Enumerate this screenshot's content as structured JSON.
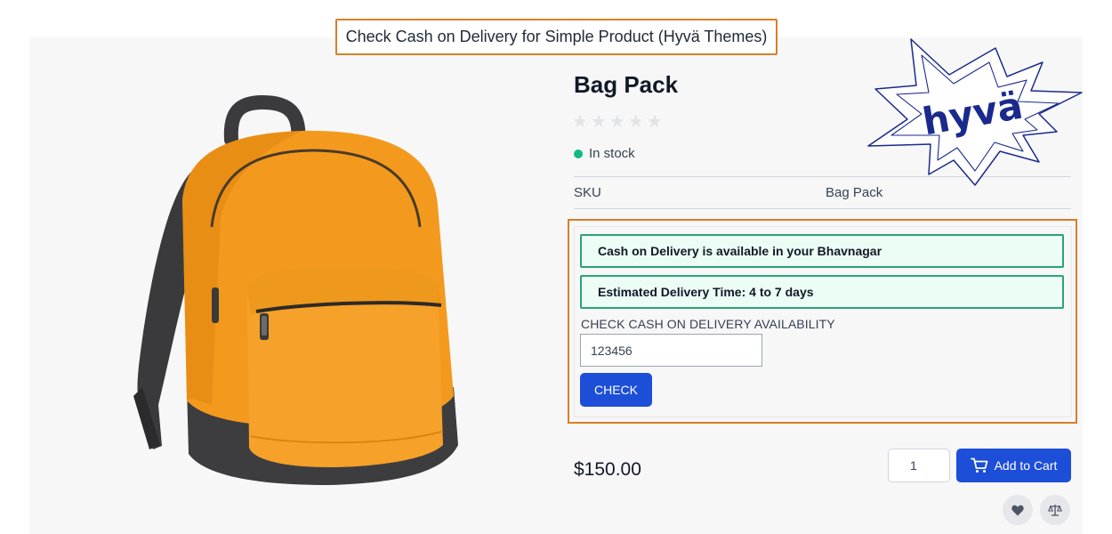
{
  "banner": {
    "title": "Check Cash on Delivery for Simple Product (Hyvä Themes)"
  },
  "logo": {
    "text": "hyvä",
    "color": "#1a2a8c"
  },
  "product": {
    "name": "Bag Pack",
    "rating": {
      "stars": 5,
      "filled": 0
    },
    "stock_status": "In stock",
    "sku_label": "SKU",
    "sku_value": "Bag Pack",
    "price": "$150.00"
  },
  "cod": {
    "message_available": "Cash on Delivery is available in your Bhavnagar",
    "message_delivery": "Estimated Delivery Time: 4 to 7 days",
    "check_label": "CHECK CASH ON DELIVERY AVAILABILITY",
    "pincode_value": "123456",
    "check_button": "CHECK"
  },
  "cart": {
    "quantity": "1",
    "add_to_cart_label": "Add to Cart"
  },
  "icons": {
    "cart": "cart-icon",
    "wishlist": "heart-icon",
    "compare": "scale-icon",
    "star": "star-icon",
    "stock": "status-dot"
  },
  "colors": {
    "accent_blue": "#1d4ed8",
    "highlight_orange": "#d77f2a",
    "success_green": "#2aa37a",
    "stock_dot": "#10b981",
    "bag_orange": "#f39a1e"
  }
}
